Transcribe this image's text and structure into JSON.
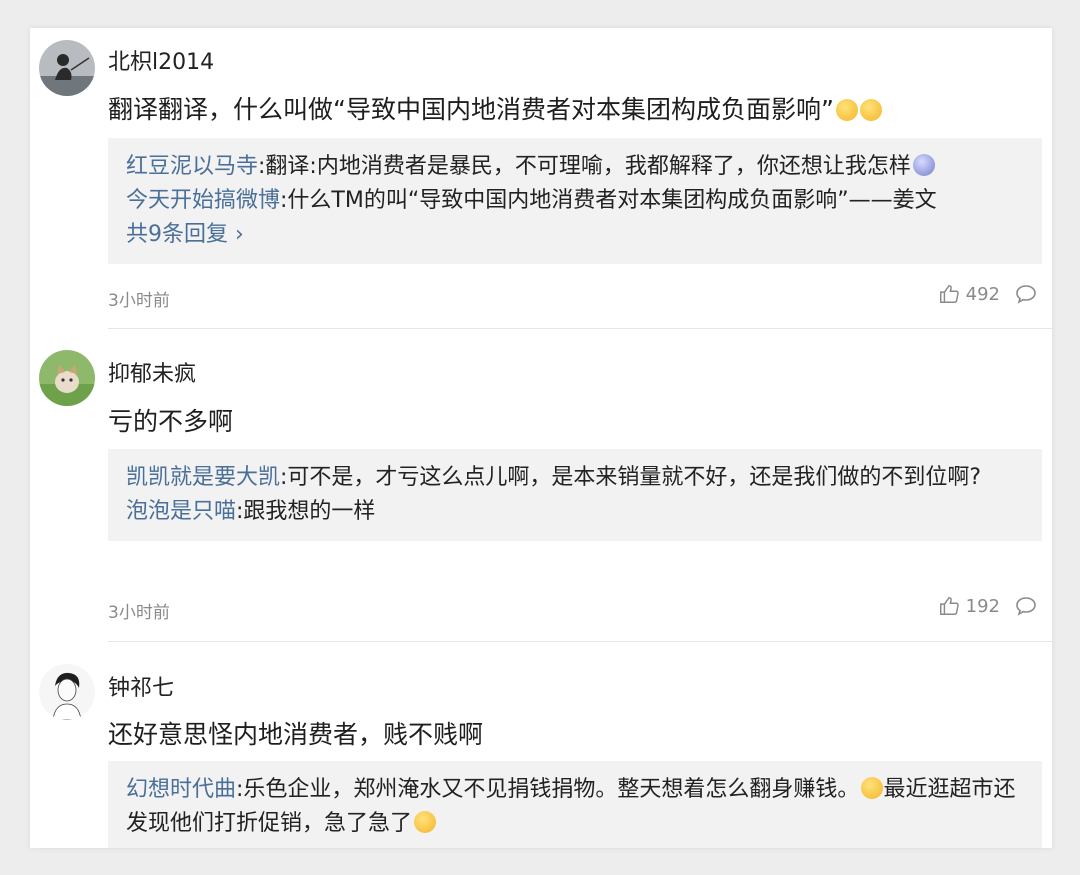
{
  "colors": {
    "link": "#4a6f98",
    "reply_bg": "#f2f2f2",
    "meta": "#8a8a8a"
  },
  "comments": [
    {
      "username": "北枳l2014",
      "text": "翻译翻译，什么叫做“导致中国内地消费者对本集团构成负面影响”",
      "text_emojis": [
        "smirk-emoji",
        "smirk-emoji"
      ],
      "avatar_icon": "avatar-person-fishing",
      "replies": [
        {
          "author": "红豆泥以马寺",
          "text": ":翻译:内地消费者是暴民，不可理喻，我都解释了，你还想让我怎样",
          "emoji": "dizzy-face-emoji"
        },
        {
          "author": "今天开始搞微博",
          "text": ":什么TM的叫“导致中国内地消费者对本集团构成负面影响”——姜文"
        }
      ],
      "more_replies": "共9条回复",
      "time": "3小时前",
      "likes": "492"
    },
    {
      "username": "抑郁未疯",
      "text": "亏的不多啊",
      "avatar_icon": "avatar-kitten",
      "replies": [
        {
          "author": "凯凯就是要大凯",
          "text": ":可不是，才亏这么点儿啊，是本来销量就不好，还是我们做的不到位啊?"
        },
        {
          "author": "泡泡是只喵",
          "text": ":跟我想的一样"
        }
      ],
      "time": "3小时前",
      "likes": "192"
    },
    {
      "username": "钟祁七",
      "text": "还好意思怪内地消费者，贱不贱啊",
      "avatar_icon": "avatar-sketch-man",
      "replies": [
        {
          "author": "幻想时代曲",
          "text": ":乐色企业，郑州淹水又不见捐钱捐物。整天想着怎么翻身赚钱。",
          "emoji": "laugh-emoji",
          "text2": "最近逛超市还发现他们打折促销，急了急了",
          "emoji2": "smile-emoji"
        }
      ]
    }
  ]
}
